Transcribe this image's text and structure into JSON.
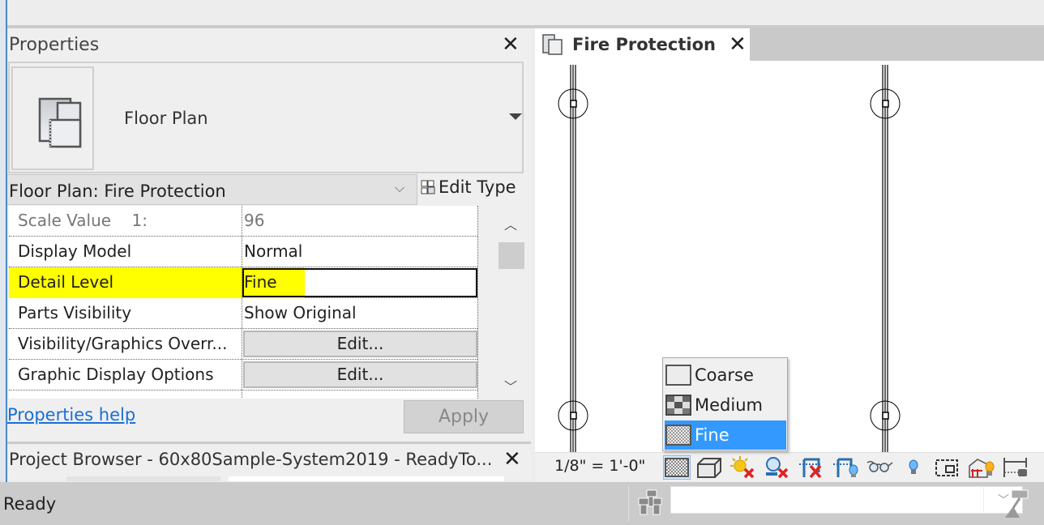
{
  "properties": {
    "title": "Properties",
    "type_name": "Floor Plan",
    "instance_selector": "Floor Plan: Fire Protection",
    "edit_type_label": "Edit Type",
    "rows": [
      {
        "name": "Scale Value    1:",
        "value": "96",
        "kind": "text",
        "disabled": true
      },
      {
        "name": "Display Model",
        "value": "Normal",
        "kind": "text"
      },
      {
        "name": "Detail Level",
        "value": "Fine",
        "kind": "input",
        "highlighted": true
      },
      {
        "name": "Parts Visibility",
        "value": "Show Original",
        "kind": "text"
      },
      {
        "name": "Visibility/Graphics Overr...",
        "value": "Edit...",
        "kind": "button"
      },
      {
        "name": "Graphic Display Options",
        "value": "Edit...",
        "kind": "button"
      }
    ],
    "help_link": "Properties help",
    "apply_label": "Apply"
  },
  "project_browser": {
    "title": "Project Browser - 60x80Sample-System2019 - ReadyTo..."
  },
  "view": {
    "tab_title": "Fire Protection",
    "scale": "1/8\" = 1'-0\"",
    "detail_level_menu": {
      "options": [
        "Coarse",
        "Medium",
        "Fine"
      ],
      "selected": "Fine"
    },
    "toolbar_icons": [
      "detail-level-icon",
      "visual-style-icon",
      "sun-path-off-icon",
      "shadows-off-icon",
      "crop-view-off-icon",
      "show-crop-region-icon",
      "temporary-hide-isolate-icon",
      "reveal-hidden-elements-icon",
      "worksharing-display-icon",
      "analytical-model-icon",
      "constraints-icon"
    ]
  },
  "status_bar": {
    "text": "Ready",
    "workset_combo_value": ""
  },
  "colors": {
    "selection_blue": "#3399ff",
    "highlight_yellow": "#ffff00",
    "link_blue": "#1a6fd8"
  }
}
